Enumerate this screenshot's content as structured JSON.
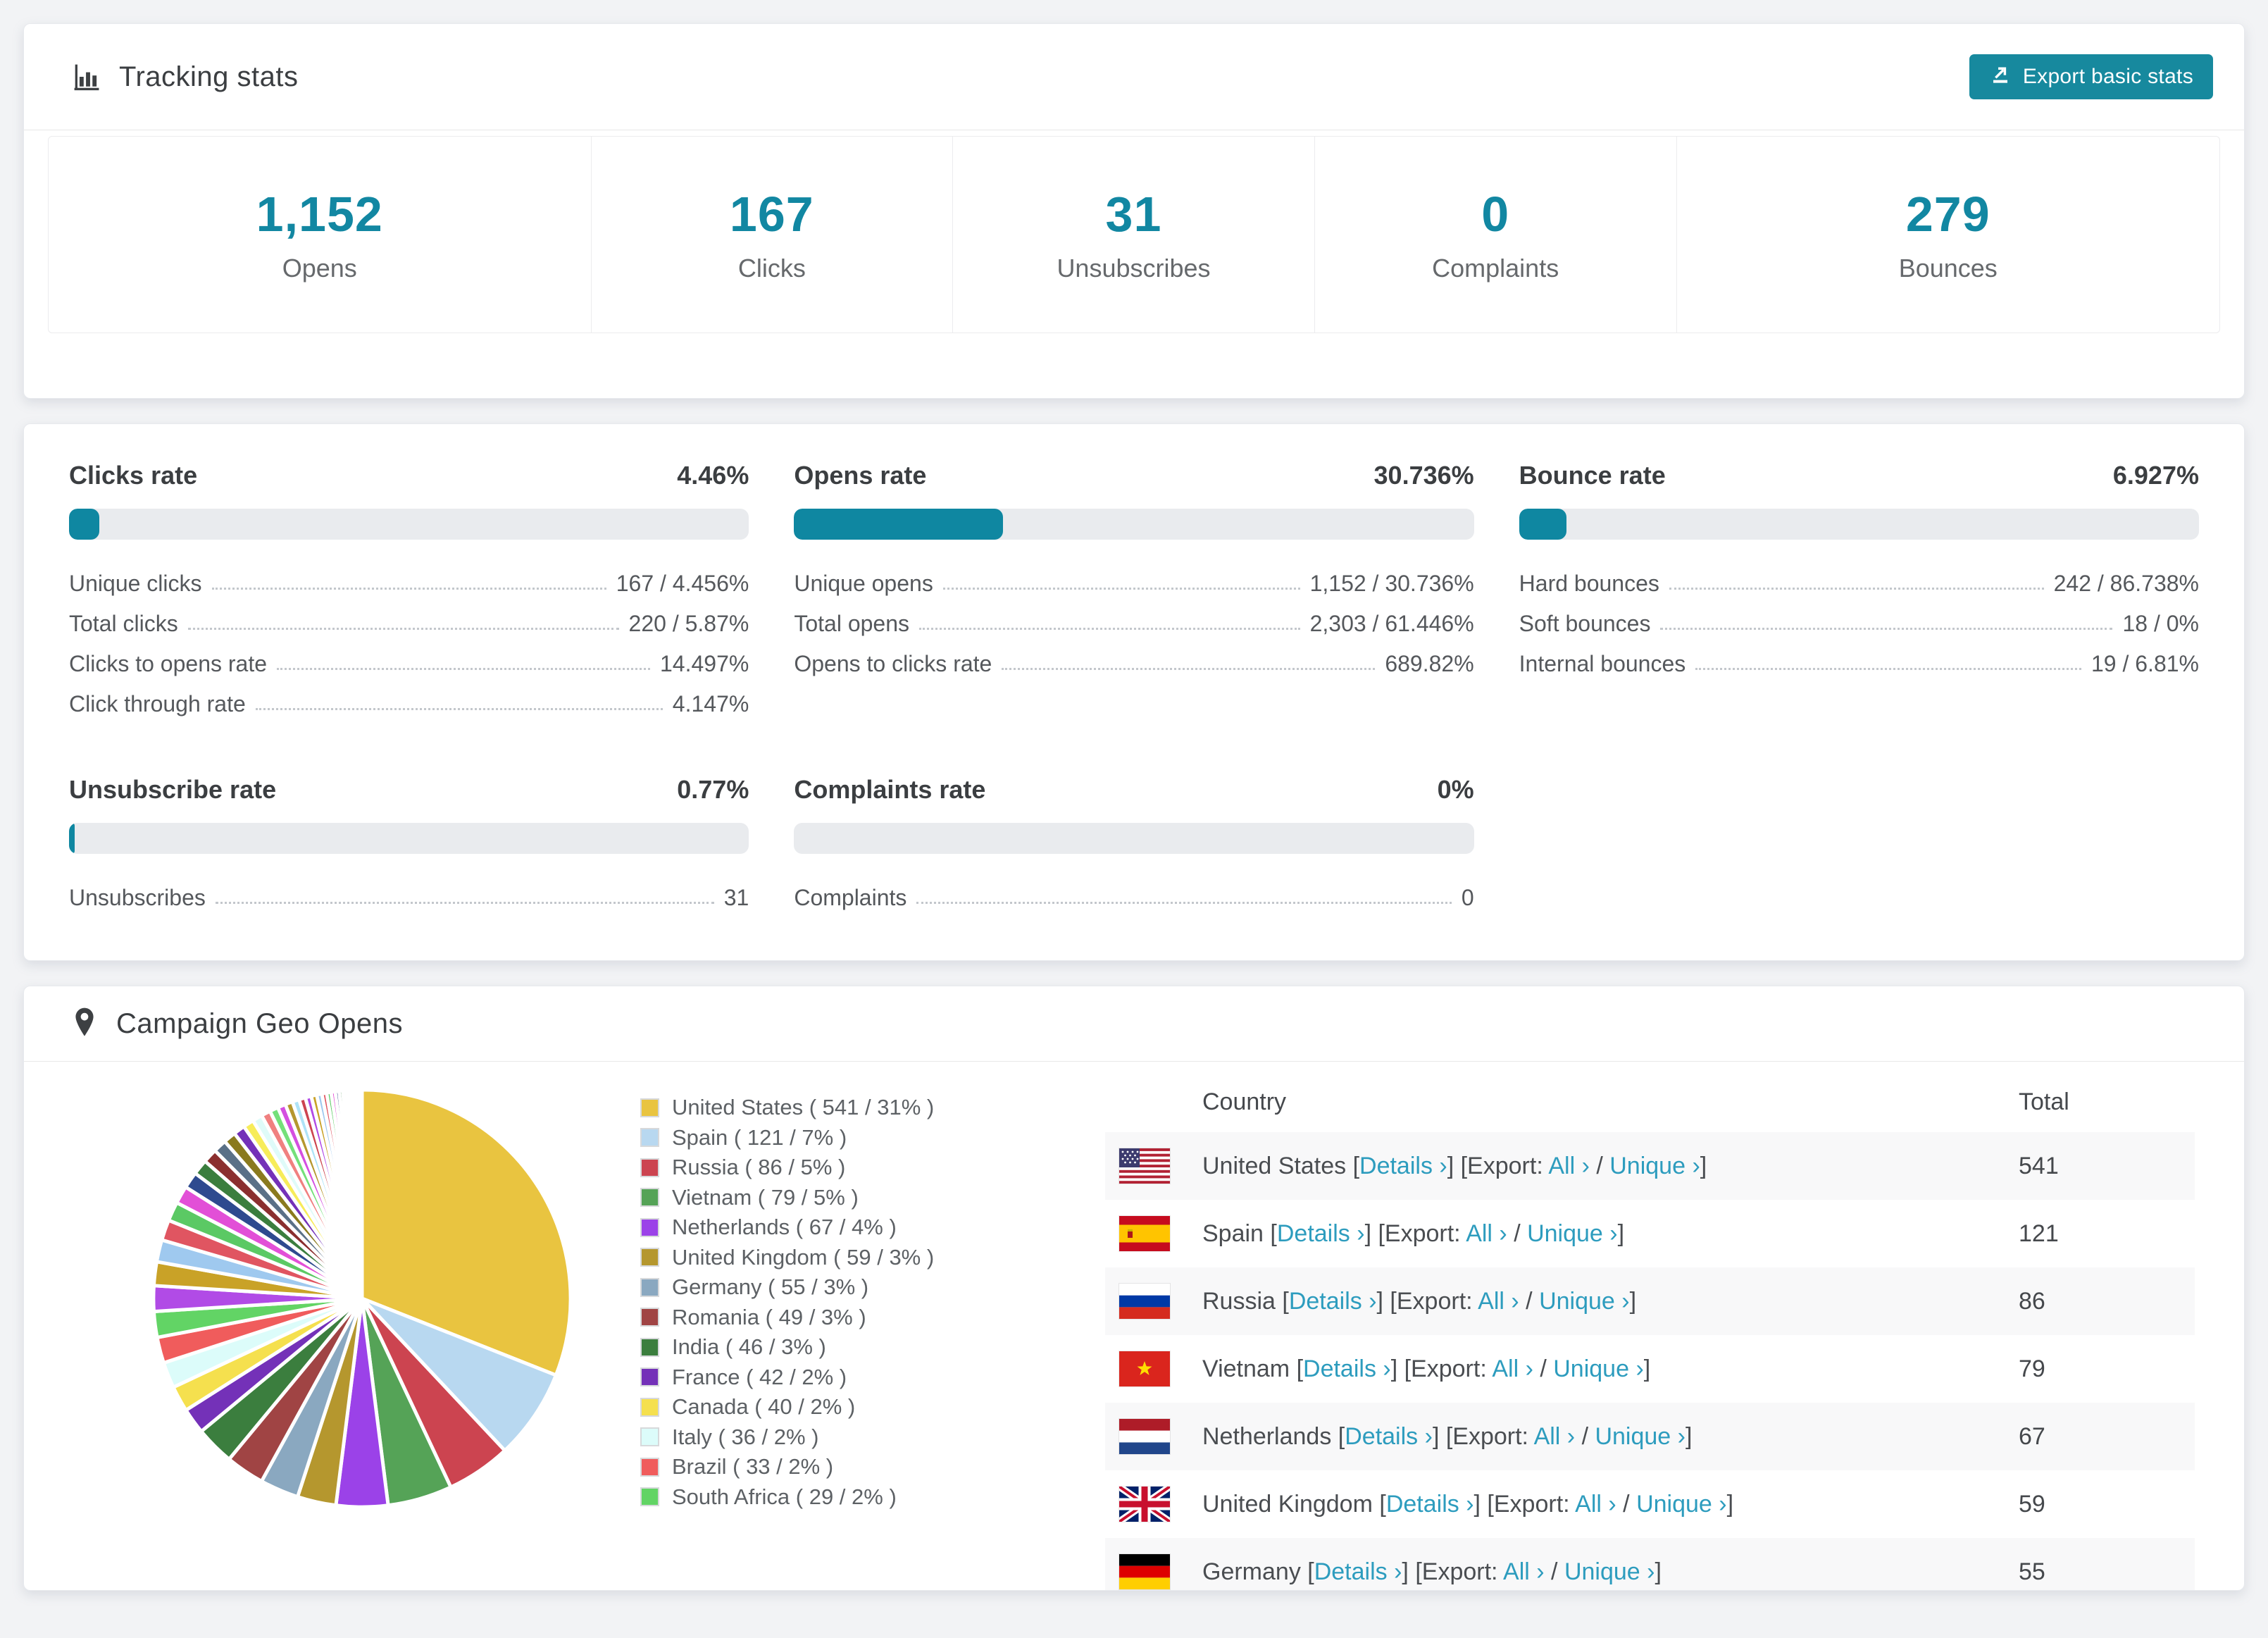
{
  "colors": {
    "accent": "#0f87a1",
    "button": "#17899e",
    "link": "#2d9cbe",
    "bar_track": "#e9ebee"
  },
  "tracking": {
    "title": "Tracking stats",
    "export_button": "Export basic stats",
    "stats": [
      {
        "value": "1,152",
        "label": "Opens"
      },
      {
        "value": "167",
        "label": "Clicks"
      },
      {
        "value": "31",
        "label": "Unsubscribes"
      },
      {
        "value": "0",
        "label": "Complaints"
      },
      {
        "value": "279",
        "label": "Bounces"
      }
    ]
  },
  "rates": [
    {
      "title": "Clicks rate",
      "value": "4.46%",
      "percent": 4.46,
      "rows": [
        {
          "label": "Unique clicks",
          "value": "167 / 4.456%"
        },
        {
          "label": "Total clicks",
          "value": "220 / 5.87%"
        },
        {
          "label": "Clicks to opens rate",
          "value": "14.497%"
        },
        {
          "label": "Click through rate",
          "value": "4.147%"
        }
      ]
    },
    {
      "title": "Opens rate",
      "value": "30.736%",
      "percent": 30.736,
      "rows": [
        {
          "label": "Unique opens",
          "value": "1,152 / 30.736%"
        },
        {
          "label": "Total opens",
          "value": "2,303 / 61.446%"
        },
        {
          "label": "Opens to clicks rate",
          "value": "689.82%"
        }
      ]
    },
    {
      "title": "Bounce rate",
      "value": "6.927%",
      "percent": 6.927,
      "rows": [
        {
          "label": "Hard bounces",
          "value": "242 / 86.738%"
        },
        {
          "label": "Soft bounces",
          "value": "18 / 0%"
        },
        {
          "label": "Internal bounces",
          "value": "19 / 6.81%"
        }
      ]
    },
    {
      "title": "Unsubscribe rate",
      "value": "0.77%",
      "percent": 0.77,
      "rows": [
        {
          "label": "Unsubscribes",
          "value": "31"
        }
      ]
    },
    {
      "title": "Complaints rate",
      "value": "0%",
      "percent": 0,
      "rows": [
        {
          "label": "Complaints",
          "value": "0"
        }
      ]
    }
  ],
  "geo": {
    "title": "Campaign Geo Opens",
    "table": {
      "headers": [
        "Country",
        "Total"
      ],
      "links": {
        "details": "Details",
        "export_prefix": "Export:",
        "all": "All",
        "unique": "Unique",
        "chevron": "›"
      },
      "rows": [
        {
          "country": "United States",
          "flag": "us",
          "total": "541"
        },
        {
          "country": "Spain",
          "flag": "es",
          "total": "121"
        },
        {
          "country": "Russia",
          "flag": "ru",
          "total": "86"
        },
        {
          "country": "Vietnam",
          "flag": "vn",
          "total": "79"
        },
        {
          "country": "Netherlands",
          "flag": "nl",
          "total": "67"
        },
        {
          "country": "United Kingdom",
          "flag": "gb",
          "total": "59"
        },
        {
          "country": "Germany",
          "flag": "de",
          "total": "55"
        }
      ]
    }
  },
  "chart_data": {
    "type": "pie",
    "title": "Campaign Geo Opens",
    "legend_position": "right",
    "labels": [
      "United States",
      "Spain",
      "Russia",
      "Vietnam",
      "Netherlands",
      "United Kingdom",
      "Germany",
      "Romania",
      "India",
      "France",
      "Canada",
      "Italy",
      "Brazil",
      "South Africa"
    ],
    "counts": [
      541,
      121,
      86,
      79,
      67,
      59,
      55,
      49,
      46,
      42,
      40,
      36,
      33,
      29
    ],
    "pct": [
      31,
      7,
      5,
      5,
      4,
      3,
      3,
      3,
      3,
      2,
      2,
      2,
      2,
      2
    ],
    "colors": [
      "#e9c440",
      "#b8d8f0",
      "#cc4450",
      "#55a357",
      "#9b42e8",
      "#b5972e",
      "#8aa8c0",
      "#a04444",
      "#3b7e3e",
      "#7431b8",
      "#f5e04e",
      "#dcfcfa",
      "#f05c5c",
      "#62d465"
    ],
    "legend_label_format": "{label} ( {count} / {pct}% )",
    "unlabeled_remainder": {
      "percent": 26,
      "slice_count": 35,
      "decay": 0.93
    }
  }
}
